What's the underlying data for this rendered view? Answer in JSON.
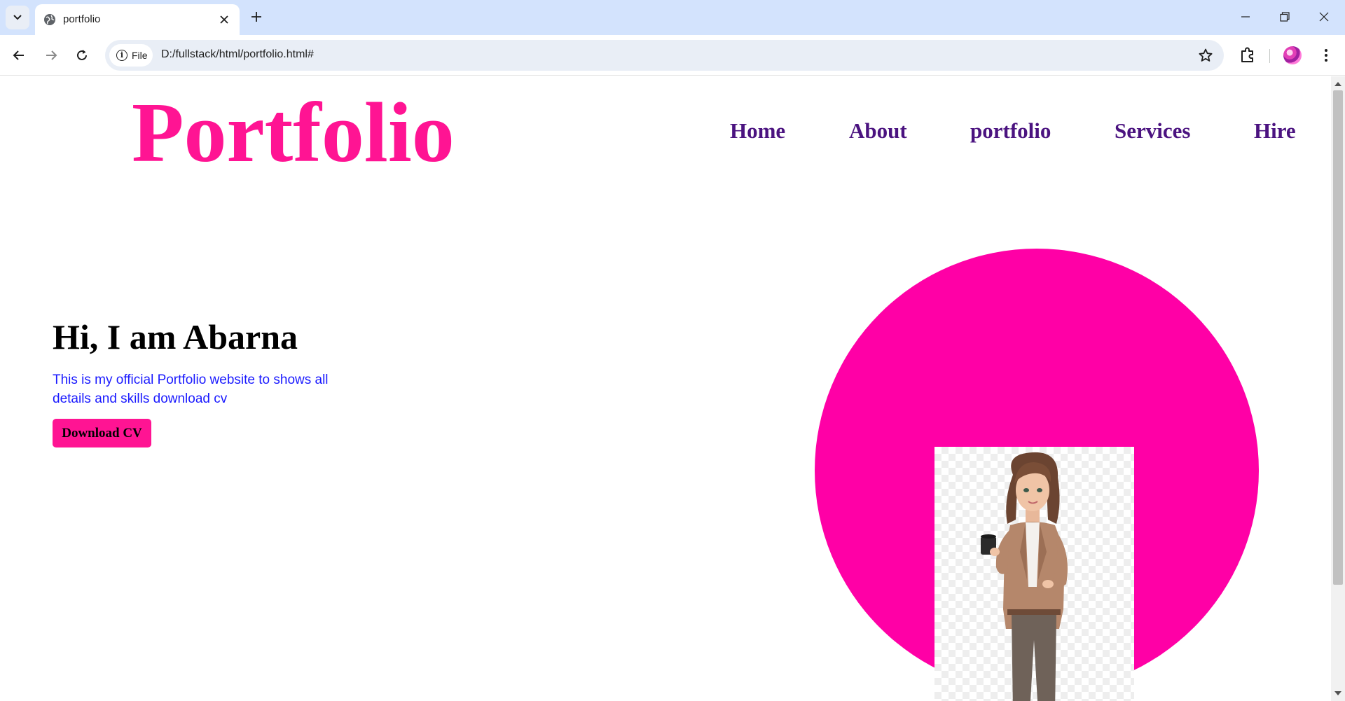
{
  "browser": {
    "tab": {
      "title": "portfolio",
      "favicon": "globe-icon",
      "close_icon": "close-icon"
    },
    "new_tab_icon": "plus-icon",
    "window_controls": [
      "minimize-icon",
      "restore-icon",
      "close-icon"
    ],
    "nav": {
      "back_icon": "arrow-left-icon",
      "forward_icon": "arrow-right-icon",
      "reload_icon": "reload-icon"
    },
    "address_bar": {
      "chip_label": "File",
      "url": "D:/fullstack/html/portfolio.html#"
    },
    "bookmark_icon": "star-icon",
    "extensions_icon": "puzzle-icon",
    "menu_icon": "more-vertical-icon"
  },
  "page": {
    "logo": "Portfolio",
    "nav": [
      {
        "label": "Home"
      },
      {
        "label": "About"
      },
      {
        "label": "portfolio"
      },
      {
        "label": "Services"
      },
      {
        "label": "Hire"
      }
    ],
    "hero": {
      "heading": "Hi, I am Abarna",
      "description": "This is my official Portfolio website to shows all details and skills download cv",
      "button": "Download CV"
    },
    "colors": {
      "accent": "#ff1493",
      "circle": "#ff00a6",
      "nav_text": "#4b1380",
      "description_text": "#1a1aff"
    }
  }
}
